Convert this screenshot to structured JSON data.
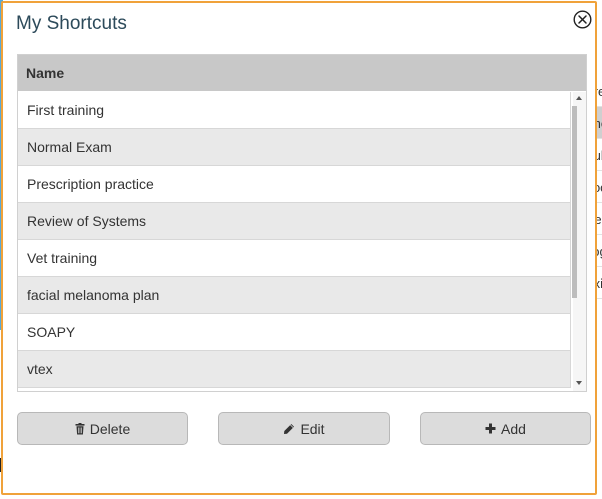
{
  "dialog": {
    "title": "My Shortcuts",
    "close_icon": "close-circle-icon",
    "table": {
      "header": "Name",
      "rows": [
        "First training",
        "Normal Exam",
        "Prescription practice",
        "Review of Systems",
        "Vet training",
        "facial melanoma plan",
        "SOAPY",
        "vtex"
      ]
    },
    "buttons": {
      "delete": {
        "label": "Delete",
        "icon": "trash-icon"
      },
      "edit": {
        "label": "Edit",
        "icon": "pencil-icon"
      },
      "add": {
        "label": "Add",
        "icon": "plus-icon"
      }
    }
  },
  "side_menu": {
    "items": [
      "Pre",
      "Sho",
      "Sub",
      "Voc",
      "He",
      "Log",
      "Exi"
    ],
    "active_index": 1
  },
  "colors": {
    "dialog_border": "#f0a23a",
    "title_text": "#2c4a5a",
    "header_bg": "#c8c8c8",
    "row_alt_bg": "#e9e9e9",
    "button_bg": "#dcdcdc"
  }
}
